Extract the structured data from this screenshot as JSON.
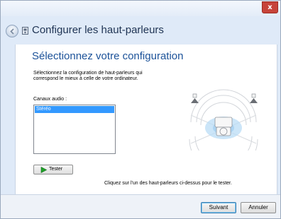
{
  "window": {
    "close_glyph": "x"
  },
  "nav": {
    "title": "Configurer les haut-parleurs",
    "back_icon": "back-arrow-icon",
    "title_icon": "speaker-config-icon"
  },
  "main": {
    "heading": "Sélectionnez votre configuration",
    "instruction": "Sélectionnez la configuration de haut-parleurs qui correspond le mieux à celle de votre ordinateur.",
    "channels_label": "Canaux audio :",
    "channels": [
      "Stéréo"
    ],
    "selected_channel": "Stéréo",
    "test_button": "Tester",
    "hint": "Cliquez sur l'un des haut-parleurs ci-dessus pour le tester."
  },
  "footer": {
    "next_button": "Suivant",
    "cancel_button": "Annuler"
  },
  "colors": {
    "heading": "#1c5299",
    "selection": "#3399ff",
    "close": "#c7443a",
    "window_bg": "#dfeaf8"
  }
}
